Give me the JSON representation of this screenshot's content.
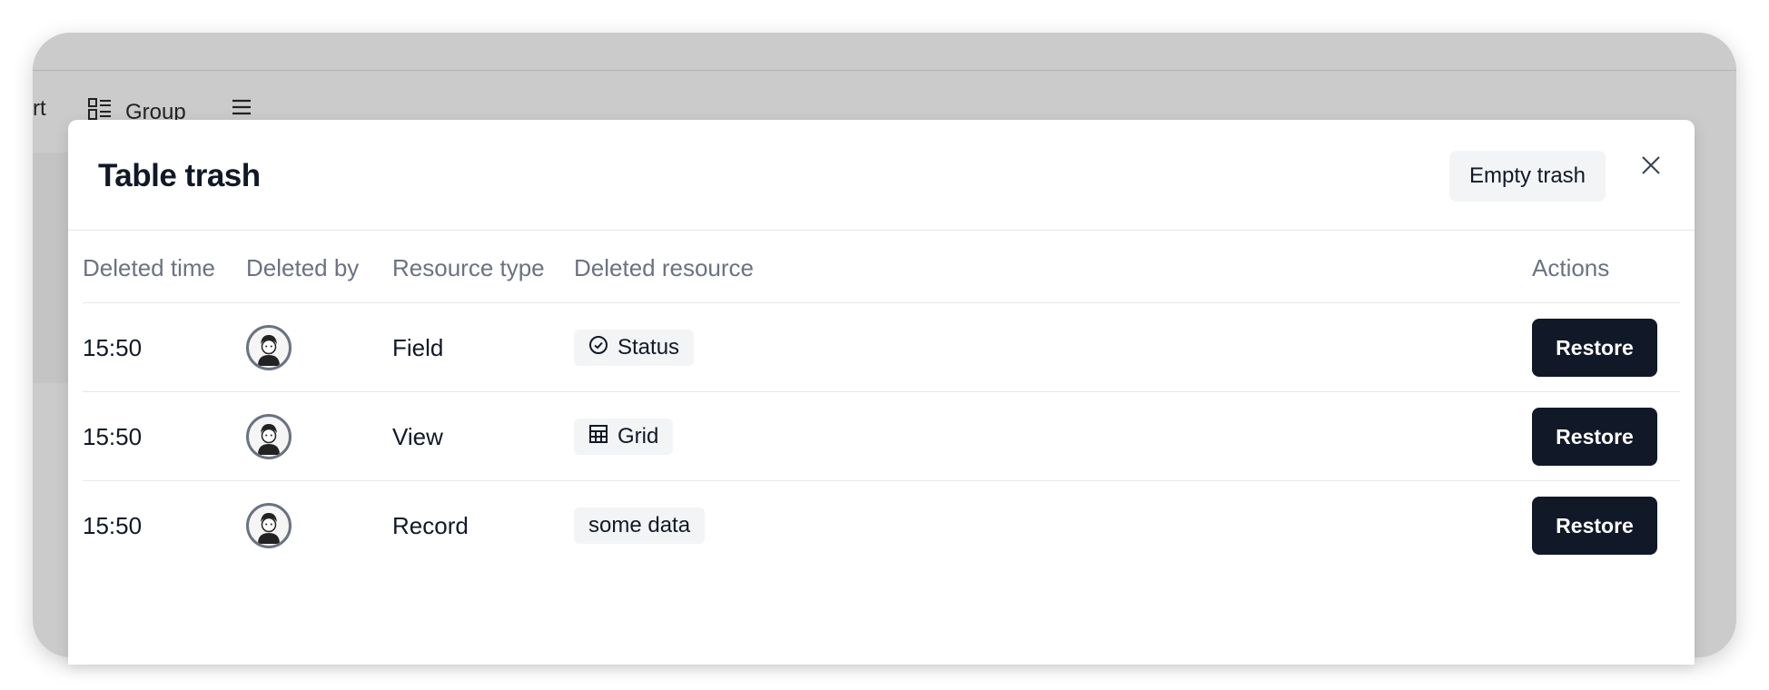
{
  "background": {
    "toolbar": [
      {
        "label": "rt",
        "icon": null
      },
      {
        "label": "Group",
        "icon": "group-icon"
      },
      {
        "label": "",
        "icon": "menu-icon"
      }
    ]
  },
  "modal": {
    "title": "Table trash",
    "empty_trash_label": "Empty trash",
    "close_icon": "close-icon"
  },
  "table": {
    "columns": [
      "Deleted time",
      "Deleted by",
      "Resource type",
      "Deleted resource",
      "Actions"
    ],
    "rows": [
      {
        "time": "15:50",
        "user_icon": "avatar",
        "type": "Field",
        "resource": "Status",
        "resource_icon": "status-check-icon",
        "action": "Restore"
      },
      {
        "time": "15:50",
        "user_icon": "avatar",
        "type": "View",
        "resource": "Grid",
        "resource_icon": "grid-table-icon",
        "action": "Restore"
      },
      {
        "time": "15:50",
        "user_icon": "avatar",
        "type": "Record",
        "resource": "some data",
        "resource_icon": null,
        "action": "Restore"
      }
    ]
  },
  "colors": {
    "overlay": "#cbcbcb",
    "modal_bg": "#ffffff",
    "primary_button": "#111827",
    "muted_text": "#6b7280",
    "chip_bg": "#f3f4f6"
  }
}
